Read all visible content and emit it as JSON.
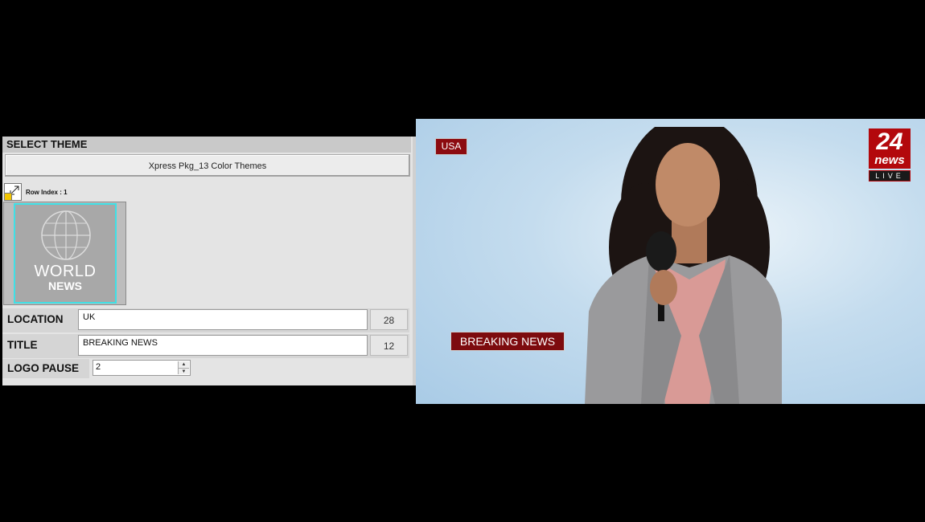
{
  "panel": {
    "section_title": "SELECT THEME",
    "theme_button": "Xpress Pkg_13 Color Themes",
    "row_index": "Row Index : 1",
    "thumbnail": {
      "line1": "WORLD",
      "line2": "NEWS"
    },
    "fields": {
      "location": {
        "label": "LOCATION",
        "value": "UK",
        "count": "28"
      },
      "title": {
        "label": "TITLE",
        "value": "BREAKING NEWS",
        "count": "12"
      },
      "logo_pause": {
        "label": "LOGO PAUSE",
        "value": "2"
      }
    }
  },
  "preview": {
    "location_tag": "USA",
    "headline": "BREAKING NEWS",
    "logo": {
      "number": "24",
      "word": "news",
      "live": "LIVE"
    },
    "colors": {
      "tag_red": "#8c0b10",
      "background": "#bcd7ec"
    }
  }
}
